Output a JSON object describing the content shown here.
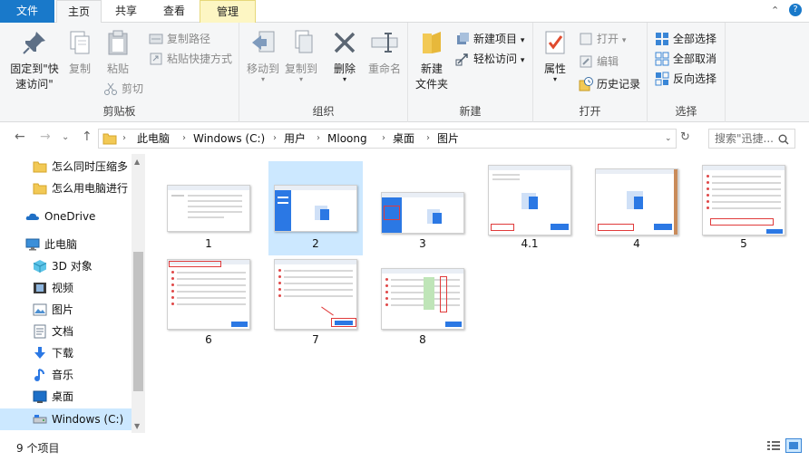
{
  "tabs": {
    "file": "文件",
    "home": "主页",
    "share": "共享",
    "view": "查看",
    "manage": "管理"
  },
  "ribbon": {
    "clipboard": {
      "label": "剪贴板",
      "pin_line1": "固定到\"快",
      "pin_line2": "速访问\"",
      "copy": "复制",
      "paste": "粘贴",
      "copy_path": "复制路径",
      "paste_shortcut": "粘贴快捷方式",
      "cut": "剪切"
    },
    "organize": {
      "label": "组织",
      "move_to": "移动到",
      "copy_to": "复制到",
      "delete": "删除",
      "rename": "重命名"
    },
    "new": {
      "label": "新建",
      "new_folder_line1": "新建",
      "new_folder_line2": "文件夹",
      "new_item": "新建项目",
      "easy_access": "轻松访问"
    },
    "open": {
      "label": "打开",
      "properties": "属性",
      "open": "打开",
      "edit": "编辑",
      "history": "历史记录"
    },
    "select": {
      "label": "选择",
      "select_all": "全部选择",
      "select_none": "全部取消",
      "invert": "反向选择"
    }
  },
  "address": {
    "segments": [
      "此电脑",
      "Windows (C:)",
      "用户",
      "Mloong",
      "桌面",
      "图片"
    ],
    "search_placeholder": "搜索\"迅捷..."
  },
  "nav": {
    "items": [
      {
        "label": "怎么同时压缩多",
        "icon": "folder-icon"
      },
      {
        "label": "怎么用电脑进行",
        "icon": "folder-icon"
      },
      {
        "label": "OneDrive",
        "icon": "cloud-icon"
      },
      {
        "label": "此电脑",
        "icon": "computer-icon"
      },
      {
        "label": "3D 对象",
        "icon": "cube-icon"
      },
      {
        "label": "视频",
        "icon": "video-icon"
      },
      {
        "label": "图片",
        "icon": "picture-icon"
      },
      {
        "label": "文档",
        "icon": "document-icon"
      },
      {
        "label": "下载",
        "icon": "download-icon"
      },
      {
        "label": "音乐",
        "icon": "music-icon"
      },
      {
        "label": "桌面",
        "icon": "desktop-icon"
      },
      {
        "label": "Windows (C:)",
        "icon": "drive-icon"
      }
    ]
  },
  "files": [
    {
      "name": "1",
      "selected": false
    },
    {
      "name": "2",
      "selected": true
    },
    {
      "name": "3",
      "selected": false
    },
    {
      "name": "4.1",
      "selected": false
    },
    {
      "name": "4",
      "selected": false
    },
    {
      "name": "5",
      "selected": false
    },
    {
      "name": "6",
      "selected": false
    },
    {
      "name": "7",
      "selected": false
    },
    {
      "name": "8",
      "selected": false
    }
  ],
  "status": {
    "count": "9 个项目"
  },
  "colors": {
    "accent": "#1979ca",
    "selection": "#cce8ff",
    "manage_tab": "#fdf6c3"
  }
}
